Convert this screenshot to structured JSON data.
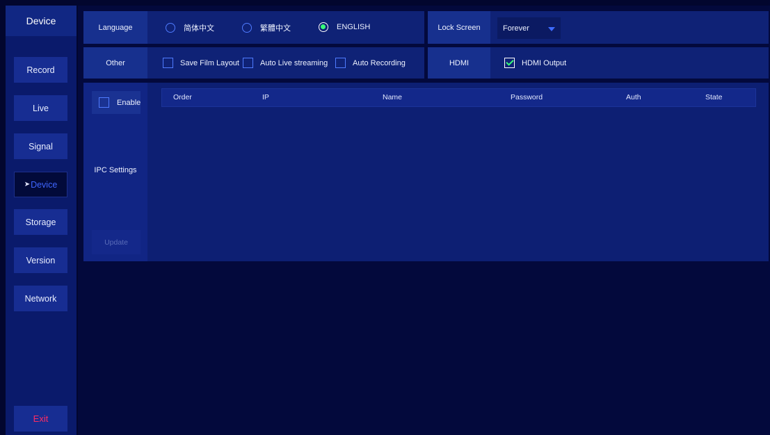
{
  "sidebar": {
    "title": "Device",
    "items": [
      {
        "label": "Record"
      },
      {
        "label": "Live"
      },
      {
        "label": "Signal"
      },
      {
        "label": "Device"
      },
      {
        "label": "Storage"
      },
      {
        "label": "Version"
      },
      {
        "label": "Network"
      }
    ],
    "exit_label": "Exit"
  },
  "language": {
    "label": "Language",
    "options": [
      "简体中文",
      "繁體中文",
      "ENGLISH"
    ],
    "selected": "ENGLISH"
  },
  "lock_screen": {
    "label": "Lock Screen",
    "value": "Forever"
  },
  "other": {
    "label": "Other",
    "save_film_layout": "Save Film Layout",
    "auto_live_streaming": "Auto Live streaming",
    "auto_recording": "Auto Recording"
  },
  "hdmi": {
    "label": "HDMI",
    "output_label": "HDMI Output",
    "output_checked": true
  },
  "ipc": {
    "enable_label": "Enable",
    "label": "IPC Settings",
    "update_label": "Update",
    "columns": [
      "Order",
      "IP",
      "Name",
      "Password",
      "Auth",
      "State"
    ]
  },
  "colors": {
    "accent": "#3f66ff",
    "checked": "#37ff7a",
    "exit": "#ff2c63"
  }
}
